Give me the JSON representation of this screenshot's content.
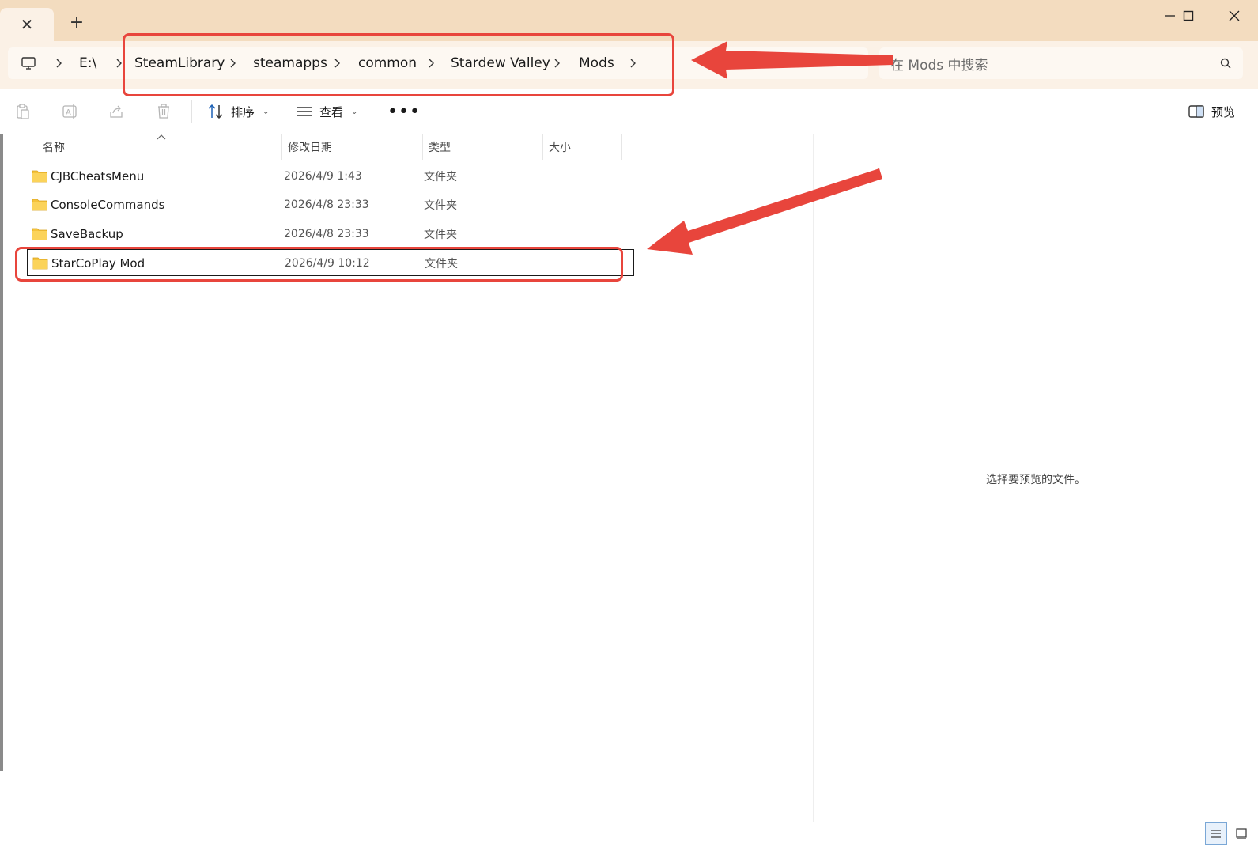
{
  "tab": {
    "close_icon": "close-icon"
  },
  "window_controls": [
    "minimize-icon",
    "maximize-icon",
    "close-icon"
  ],
  "address": {
    "segments": [
      "E:\\",
      "SteamLibrary",
      "steamapps",
      "common",
      "Stardew Valley",
      "Mods"
    ],
    "root_icon": "computer-icon"
  },
  "search": {
    "placeholder": "在 Mods 中搜索"
  },
  "toolbar": {
    "sort_label": "排序",
    "view_label": "查看",
    "more_label": "•••",
    "preview_label": "预览"
  },
  "columns": [
    "名称",
    "修改日期",
    "类型",
    "大小"
  ],
  "files": [
    {
      "name": "CJBCheatsMenu",
      "date": "2026/4/9 1:43",
      "type": "文件夹",
      "size": ""
    },
    {
      "name": "ConsoleCommands",
      "date": "2026/4/8 23:33",
      "type": "文件夹",
      "size": ""
    },
    {
      "name": "SaveBackup",
      "date": "2026/4/8 23:33",
      "type": "文件夹",
      "size": ""
    },
    {
      "name": "StarCoPlay Mod",
      "date": "2026/4/9 10:12",
      "type": "文件夹",
      "size": ""
    }
  ],
  "preview": {
    "empty_message": "选择要预览的文件。"
  },
  "colors": {
    "annotation_red": "#e8453c",
    "titlebar": "#f3dcbf",
    "toolbar_bg": "#fbf1e6",
    "folder_yellow": "#f5c33b"
  }
}
